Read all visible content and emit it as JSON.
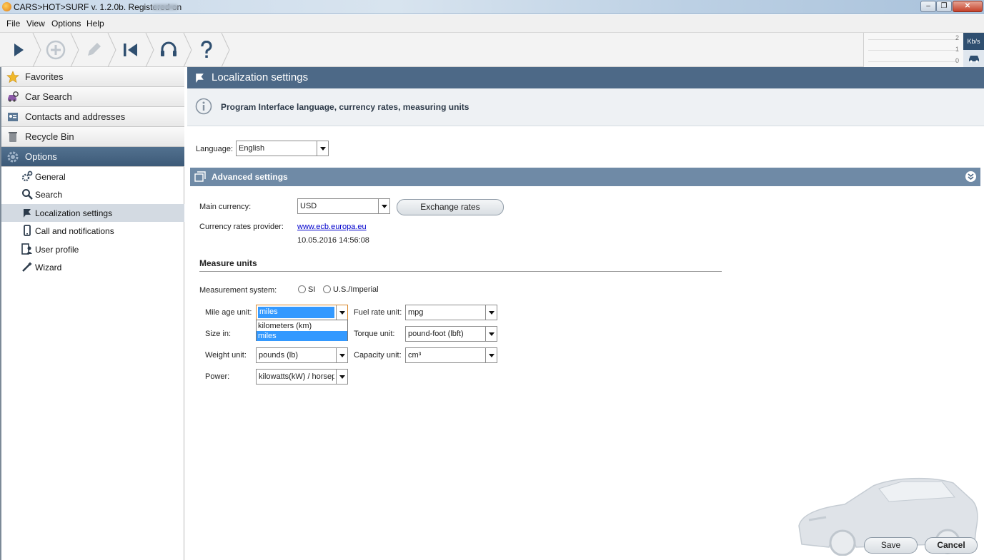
{
  "window": {
    "title": "CARS>HOT>SURF v. 1.2.0b. Registered on",
    "minimize_icon": "minimize-icon",
    "maximize_icon": "maximize-icon",
    "close_icon": "close-icon"
  },
  "menu": {
    "items": [
      "File",
      "View",
      "Options",
      "Help"
    ]
  },
  "toolbar": {
    "buttons": [
      "play-icon",
      "add-icon",
      "edit-icon",
      "back-to-start-icon",
      "support-headset-icon",
      "help-icon"
    ],
    "speed_labels": [
      "2",
      "1",
      "0"
    ],
    "speed_unit": "Kb/s",
    "car_icon": "car-icon"
  },
  "sidebar": {
    "sections": [
      {
        "label": "Favorites",
        "icon": "star-icon"
      },
      {
        "label": "Car Search",
        "icon": "car-search-icon"
      },
      {
        "label": "Contacts and addresses",
        "icon": "contacts-icon"
      },
      {
        "label": "Recycle Bin",
        "icon": "recycle-bin-icon"
      },
      {
        "label": "Options",
        "icon": "gear-icon",
        "active": true
      }
    ],
    "options_items": [
      {
        "label": "General",
        "icon": "gears-icon"
      },
      {
        "label": "Search",
        "icon": "magnifier-icon"
      },
      {
        "label": "Localization settings",
        "icon": "flag-icon",
        "selected": true
      },
      {
        "label": "Call and notifications",
        "icon": "phone-icon"
      },
      {
        "label": "User profile",
        "icon": "user-profile-icon"
      },
      {
        "label": "Wizard",
        "icon": "wand-icon"
      }
    ]
  },
  "main": {
    "header": "Localization settings",
    "info": "Program Interface language, currency rates, measuring units",
    "language_label": "Language:",
    "language_value": "English",
    "advanced_title": "Advanced settings",
    "main_currency_label": "Main currency:",
    "main_currency_value": "USD",
    "exchange_rates_button": "Exchange rates",
    "currency_provider_label": "Currency rates provider:",
    "currency_provider_link": "www.ecb.europa.eu",
    "currency_provider_date": "10.05.2016 14:56:08",
    "measure_units_title": "Measure units",
    "measurement_system_label": "Measurement system:",
    "measurement_options": [
      "SI",
      "U.S./Imperial"
    ],
    "mileage_label": "Mile age unit:",
    "mileage_value": "miles",
    "mileage_dropdown_options": [
      "kilometers (km)",
      "miles"
    ],
    "mileage_dropdown_selected": "miles",
    "size_label": "Size in:",
    "weight_label": "Weight unit:",
    "weight_value": "pounds (lb)",
    "power_label": "Power:",
    "power_value": "kilowatts(kW) / horsepo",
    "fuel_label": "Fuel rate unit:",
    "fuel_value": "mpg",
    "torque_label": "Torque unit:",
    "torque_value": "pound-foot (lbft)",
    "capacity_label": "Capacity unit:",
    "capacity_value": "cm³",
    "save_button": "Save",
    "cancel_button": "Cancel"
  },
  "colors": {
    "header_blue": "#4d6987",
    "advanced_bar": "#6f8aa6",
    "selection_blue": "#3399ff",
    "sidebar_selected": "#d3dae2"
  }
}
